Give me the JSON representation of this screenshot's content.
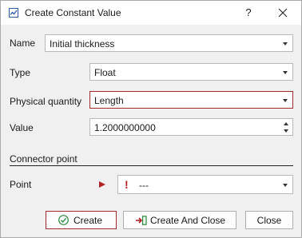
{
  "window": {
    "title": "Create Constant Value",
    "help_label": "?"
  },
  "form": {
    "name": {
      "label": "Name",
      "value": "Initial thickness"
    },
    "type": {
      "label": "Type",
      "value": "Float"
    },
    "physical_quantity": {
      "label": "Physical quantity",
      "value": "Length"
    },
    "value": {
      "label": "Value",
      "value": "1.2000000000"
    }
  },
  "connector": {
    "section_title": "Connector point",
    "point": {
      "label": "Point",
      "value": "---",
      "warning_glyph": "!"
    }
  },
  "buttons": {
    "create": "Create",
    "create_and_close": "Create And Close",
    "close": "Close"
  },
  "colors": {
    "accent_red": "#a52a2a",
    "check_green": "#2e8b3e",
    "title_icon_blue": "#2b5aa6"
  }
}
